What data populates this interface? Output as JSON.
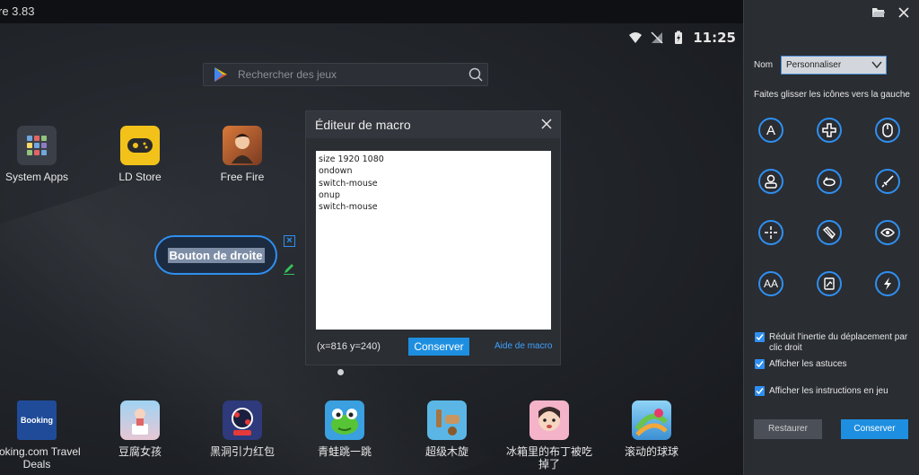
{
  "window": {
    "title": "re 3.83"
  },
  "status": {
    "time": "11:25"
  },
  "search": {
    "placeholder": "Rechercher des jeux"
  },
  "apps_top": [
    {
      "label": "System Apps"
    },
    {
      "label": "LD Store"
    },
    {
      "label": "Free Fire"
    }
  ],
  "apps_bottom": [
    {
      "label": "ooking.com Travel\nDeals",
      "badge": "Booking"
    },
    {
      "label": "豆腐女孩"
    },
    {
      "label": "黑洞引力红包"
    },
    {
      "label": "青蛙跳一跳"
    },
    {
      "label": "超级木旋"
    },
    {
      "label": "冰箱里的布丁被吃\n掉了"
    },
    {
      "label": "滚动的球球"
    }
  ],
  "key_mapping": {
    "label": "Bouton de droite"
  },
  "macro_dialog": {
    "title": "Éditeur de macro",
    "script": "size 1920 1080\nondown\nswitch-mouse\nonup\nswitch-mouse",
    "coords": "(x=816  y=240)",
    "save_label": "Conserver",
    "help_label": "Aide de macro"
  },
  "panel": {
    "nom_label": "Nom",
    "preset_value": "Personnaliser",
    "drag_hint": "Faites glisser les icônes vers la gauche",
    "options": [
      {
        "label": "Réduit l'inertie du déplacement par clic droit",
        "checked": true
      },
      {
        "label": "Afficher les astuces",
        "checked": true
      },
      {
        "label": "Afficher les instructions en jeu",
        "checked": true
      }
    ],
    "restore_label": "Restaurer",
    "save_label": "Conserver"
  },
  "colors": {
    "accent": "#2f8ff0",
    "save_button": "#1e8fe0"
  }
}
